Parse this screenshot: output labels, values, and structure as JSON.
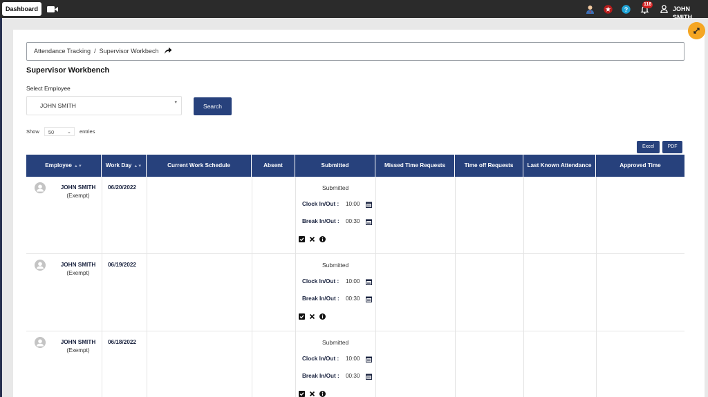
{
  "topbar": {
    "dashboard_label": "Dashboard",
    "notification_count": "118",
    "user_name": "JOHN SMITH"
  },
  "breadcrumb": {
    "items": [
      "Attendance Tracking",
      "Supervisor Workbech"
    ],
    "separator": "/"
  },
  "page": {
    "title": "Supervisor Workbench",
    "select_label": "Select Employee",
    "selected_employee": "JOHN SMITH",
    "search_label": "Search"
  },
  "table_controls": {
    "show_label": "Show",
    "entries_value": "50",
    "entries_label": "entries",
    "excel_label": "Excel",
    "pdf_label": "PDF"
  },
  "table": {
    "columns": [
      "Employee",
      "Work Day",
      "Current Work Schedule",
      "Absent",
      "Submitted",
      "Missed Time Requests",
      "Time off Requests",
      "Last Known Attendance",
      "Approved Time"
    ],
    "clock_label": "Clock In/Out :",
    "break_label": "Break In/Out :",
    "rows": [
      {
        "name": "JOHN SMITH",
        "type": "(Exempt)",
        "work_day": "06/20/2022",
        "status": "Submitted",
        "clock": "10:00",
        "break": "00:30"
      },
      {
        "name": "JOHN SMITH",
        "type": "(Exempt)",
        "work_day": "06/19/2022",
        "status": "Submitted",
        "clock": "10:00",
        "break": "00:30"
      },
      {
        "name": "JOHN SMITH",
        "type": "(Exempt)",
        "work_day": "06/18/2022",
        "status": "Submitted",
        "clock": "10:00",
        "break": "00:30"
      }
    ]
  },
  "colors": {
    "topbar_bg": "#2b2b2b",
    "header_blue": "#27417c",
    "accent_orange": "#f5a623",
    "badge_red": "#d32020"
  },
  "icons": [
    "video-camera-icon",
    "user-tie-icon",
    "star-badge-icon",
    "help-icon",
    "bell-icon",
    "user-icon",
    "expand-icon",
    "share-arrow-icon",
    "calendar-icon",
    "check-icon",
    "close-icon",
    "info-icon",
    "avatar-icon"
  ]
}
